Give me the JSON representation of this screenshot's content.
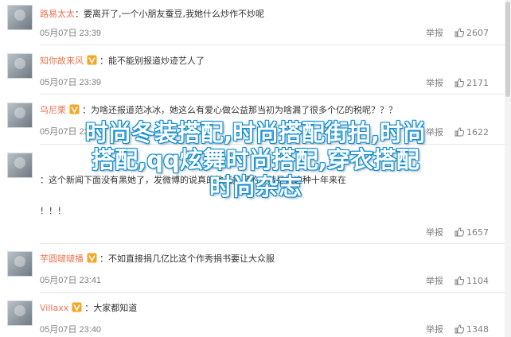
{
  "comments": [
    {
      "user": "路易太太",
      "vip": false,
      "text": "：要离开了,一个小朋友蚕豆,我她什么炒作不炒呢",
      "time": "05月07日 23:39",
      "report": "举报",
      "likes": "2607"
    },
    {
      "user": "知你故来风",
      "vip": true,
      "text": "：能不能别报道炒迹艺人了",
      "time": "05月07日 23:39",
      "report": "举报",
      "likes": "2171"
    },
    {
      "user": "乌尼栗",
      "vip": true,
      "text": "：为啥还报道范冰冰，她这么有爱心做公益那当初为啥漏了很多个亿的税呢？？？",
      "time": "05月07日 23:41",
      "report": "举报",
      "likes": "1622"
    },
    {
      "user": "",
      "vip": false,
      "text": "",
      "time": "",
      "report": "举报",
      "likes": "1657",
      "extra_lines": [
        "：这个新闻下面没有黑她了，发微博的说真的她还挺好的，就是她这种十年来在",
        "！！！"
      ]
    },
    {
      "user": "芋圆啵啵播",
      "vip": true,
      "text": "：不如直接捐几亿比这个作秀捐书要让大众服",
      "time": "05月07日 23:41",
      "report": "举报",
      "likes": "1104"
    },
    {
      "user": "Villaxx",
      "vip": true,
      "text": "：大家都知道",
      "time": "05月07日 23:40",
      "report": "举报",
      "likes": "1348"
    }
  ],
  "overlay": {
    "line1": "时尚冬装搭配,时尚搭配街拍,时尚",
    "line2": "搭配,qq炫舞时尚搭配,穿衣搭配",
    "line3": "时尚杂志"
  },
  "colors": {
    "username": "#eb7350",
    "overlay_stroke": "#0e8fd6"
  }
}
